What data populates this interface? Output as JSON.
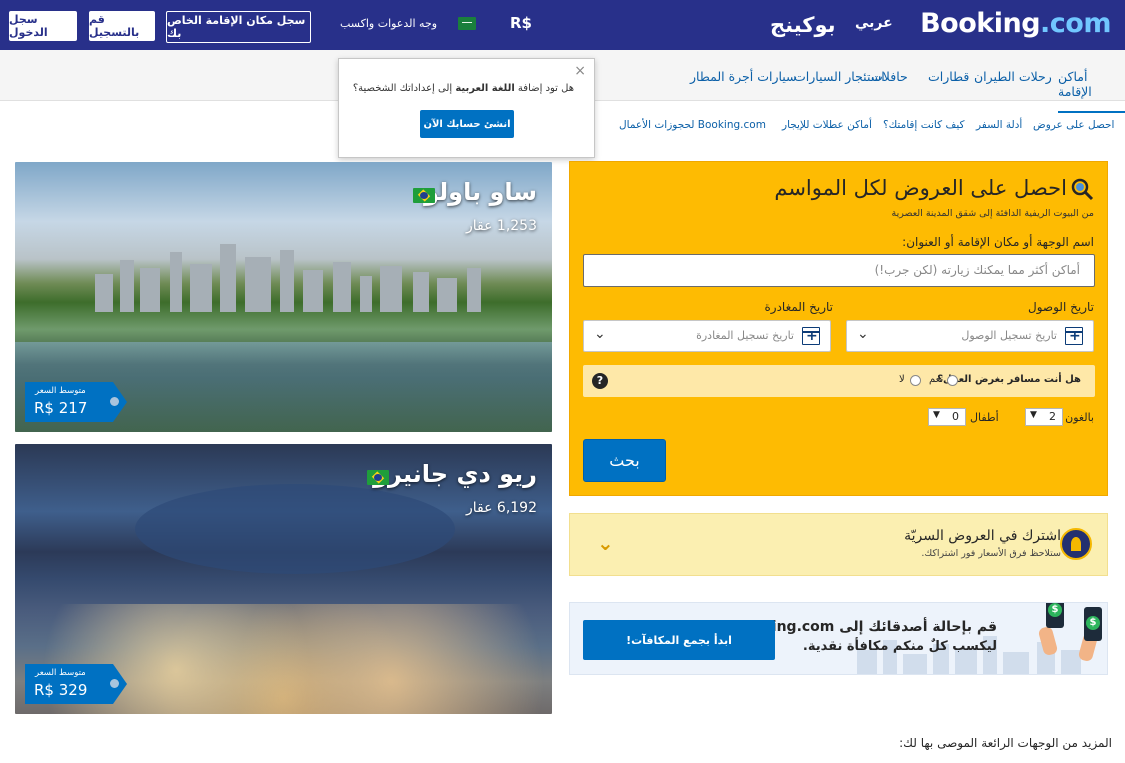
{
  "header": {
    "logo_main": "Booking",
    "logo_dot": ".com",
    "logo_arabic": "بوكينج",
    "language": "عربي",
    "currency": "R$",
    "invite_text": "وجه الدعوات واكسب",
    "list_property": "سجل مكان الإقامة الخاص بك",
    "register": "قم بالتسجيل",
    "sign_in": "سجل الدخول"
  },
  "nav": {
    "items": [
      "أماكن الإقامة",
      "رحلات الطيران",
      "قطارات",
      "حافلات",
      "استئجار السيارات",
      "سيارات أجرة المطار"
    ]
  },
  "popup": {
    "question_prefix": "هل تود إضافة ",
    "question_bold": "اللغة العربية",
    "question_suffix": " إلى إعداداتك الشخصية؟",
    "button": "انشئ حسابك الآن",
    "close": "×"
  },
  "sublinks": [
    "احصل على عروض",
    "أدلة السفر",
    "كيف كانت إقامتك؟",
    "أماكن عطلات للإيجار",
    "Booking.com لحجوزات الأعمال"
  ],
  "destinations": [
    {
      "name": "ساو باولو",
      "properties": "1,253 عقار",
      "price_label": "متوسط السعر",
      "price": "R$ 217"
    },
    {
      "name": "ريو دي جانيرو",
      "properties": "6,192 عقار",
      "price_label": "متوسط السعر",
      "price": "R$ 329"
    }
  ],
  "search": {
    "title": "احصل على العروض لكل المواسم",
    "subtitle": "من البيوت الريفية الدافئة إلى شقق المدينة العصرية",
    "dest_label": "اسم الوجهة أو مكان الإقامة أو العنوان:",
    "dest_placeholder": "أماكن أكثر مما يمكنك زيارته (لكن جرب!)",
    "checkin_label": "تاريخ الوصول",
    "checkout_label": "تاريخ المغادرة",
    "checkin_placeholder": "تاريخ تسجيل الوصول",
    "checkout_placeholder": "تاريخ تسجيل المغادرة",
    "business_question": "هل أنت مسافر بغرض العمل؟",
    "yes": "نعم",
    "no": "لا",
    "help": "?",
    "adults_label": "بالغون",
    "adults_value": "2",
    "children_label": "أطفال",
    "children_value": "0",
    "button": "بحث"
  },
  "deals": {
    "title": "اشترك في العروض السريّة",
    "subtitle": "ستلاحظ فرق الأسعار فور اشتراكك."
  },
  "referral": {
    "line1": "قم بإحالة أصدقائك إلى Booking.com",
    "line2": "ليكسب كلٌ منكم مكافأة نقدية.",
    "button": "ابدأ بجمع المكافآت!"
  },
  "more_destinations": "المزيد من الوجهات الرائعة الموصى بها لك:"
}
